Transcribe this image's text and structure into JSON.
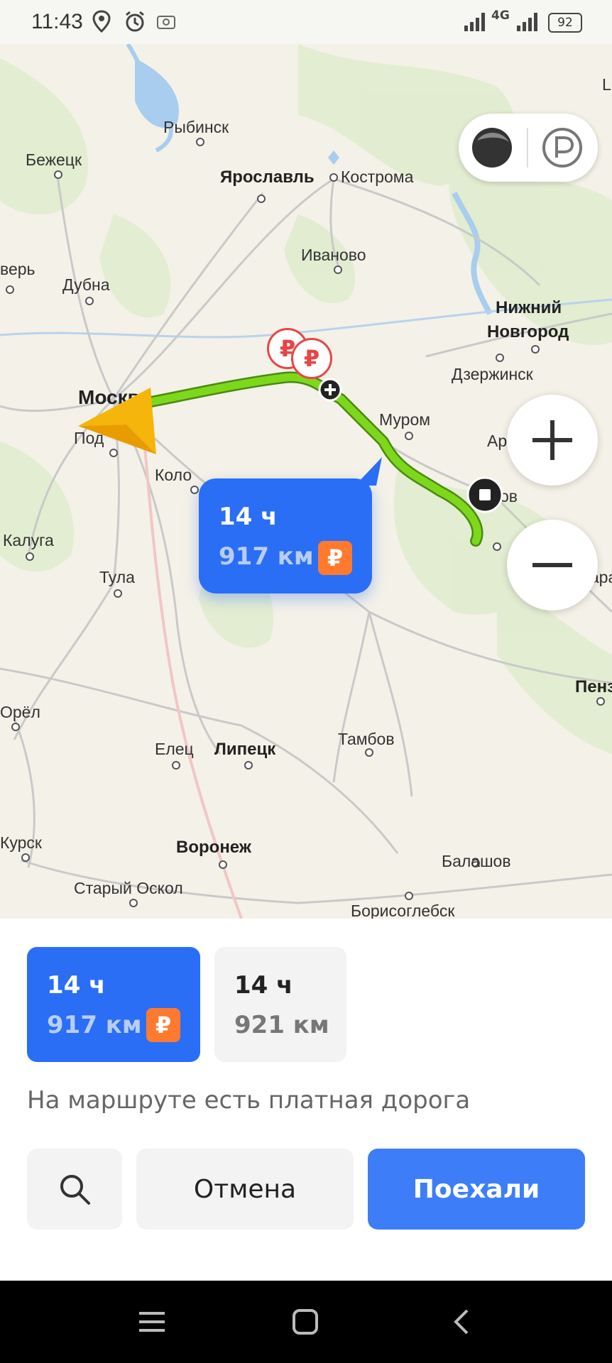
{
  "status_bar": {
    "time": "11:43",
    "network": "4G",
    "battery": "92"
  },
  "map": {
    "cities": [
      {
        "name": "Рыбинск"
      },
      {
        "name": "Бежецк"
      },
      {
        "name": "Ярославль"
      },
      {
        "name": "Кострома"
      },
      {
        "name": "Иваново"
      },
      {
        "name": "верь"
      },
      {
        "name": "Дубна"
      },
      {
        "name": "Нижний"
      },
      {
        "name": "Новгород"
      },
      {
        "name": "Дзержинск"
      },
      {
        "name": "Москва"
      },
      {
        "name": "Под"
      },
      {
        "name": "Коло"
      },
      {
        "name": "Муром"
      },
      {
        "name": "Арзам"
      },
      {
        "name": "ов"
      },
      {
        "name": "Калуга"
      },
      {
        "name": "Тула"
      },
      {
        "name": "Сара"
      },
      {
        "name": "Пенз"
      },
      {
        "name": "Орёл"
      },
      {
        "name": "Елец"
      },
      {
        "name": "Липецк"
      },
      {
        "name": "Тамбов"
      },
      {
        "name": "Курск"
      },
      {
        "name": "Воронеж"
      },
      {
        "name": "Балашов"
      },
      {
        "name": "Старый Оскол"
      },
      {
        "name": "Борисоглебск"
      },
      {
        "name": "L"
      }
    ],
    "route_bubble": {
      "time": "14 ч",
      "distance": "917 км",
      "toll_symbol": "₽"
    },
    "toll_markers": [
      "₽",
      "₽"
    ],
    "zoom_in": "+",
    "zoom_out": "−"
  },
  "route_options": [
    {
      "time": "14 ч",
      "distance": "917 км",
      "toll_symbol": "₽",
      "selected": true
    },
    {
      "time": "14 ч",
      "distance": "921 км",
      "selected": false
    }
  ],
  "toll_notice": "На маршруте есть платная дорога",
  "buttons": {
    "search": "search-icon",
    "cancel": "Отмена",
    "go": "Поехали"
  },
  "colors": {
    "accent": "#2a6ef5",
    "toll": "#ff7a2e",
    "route": "#7dd81c"
  }
}
